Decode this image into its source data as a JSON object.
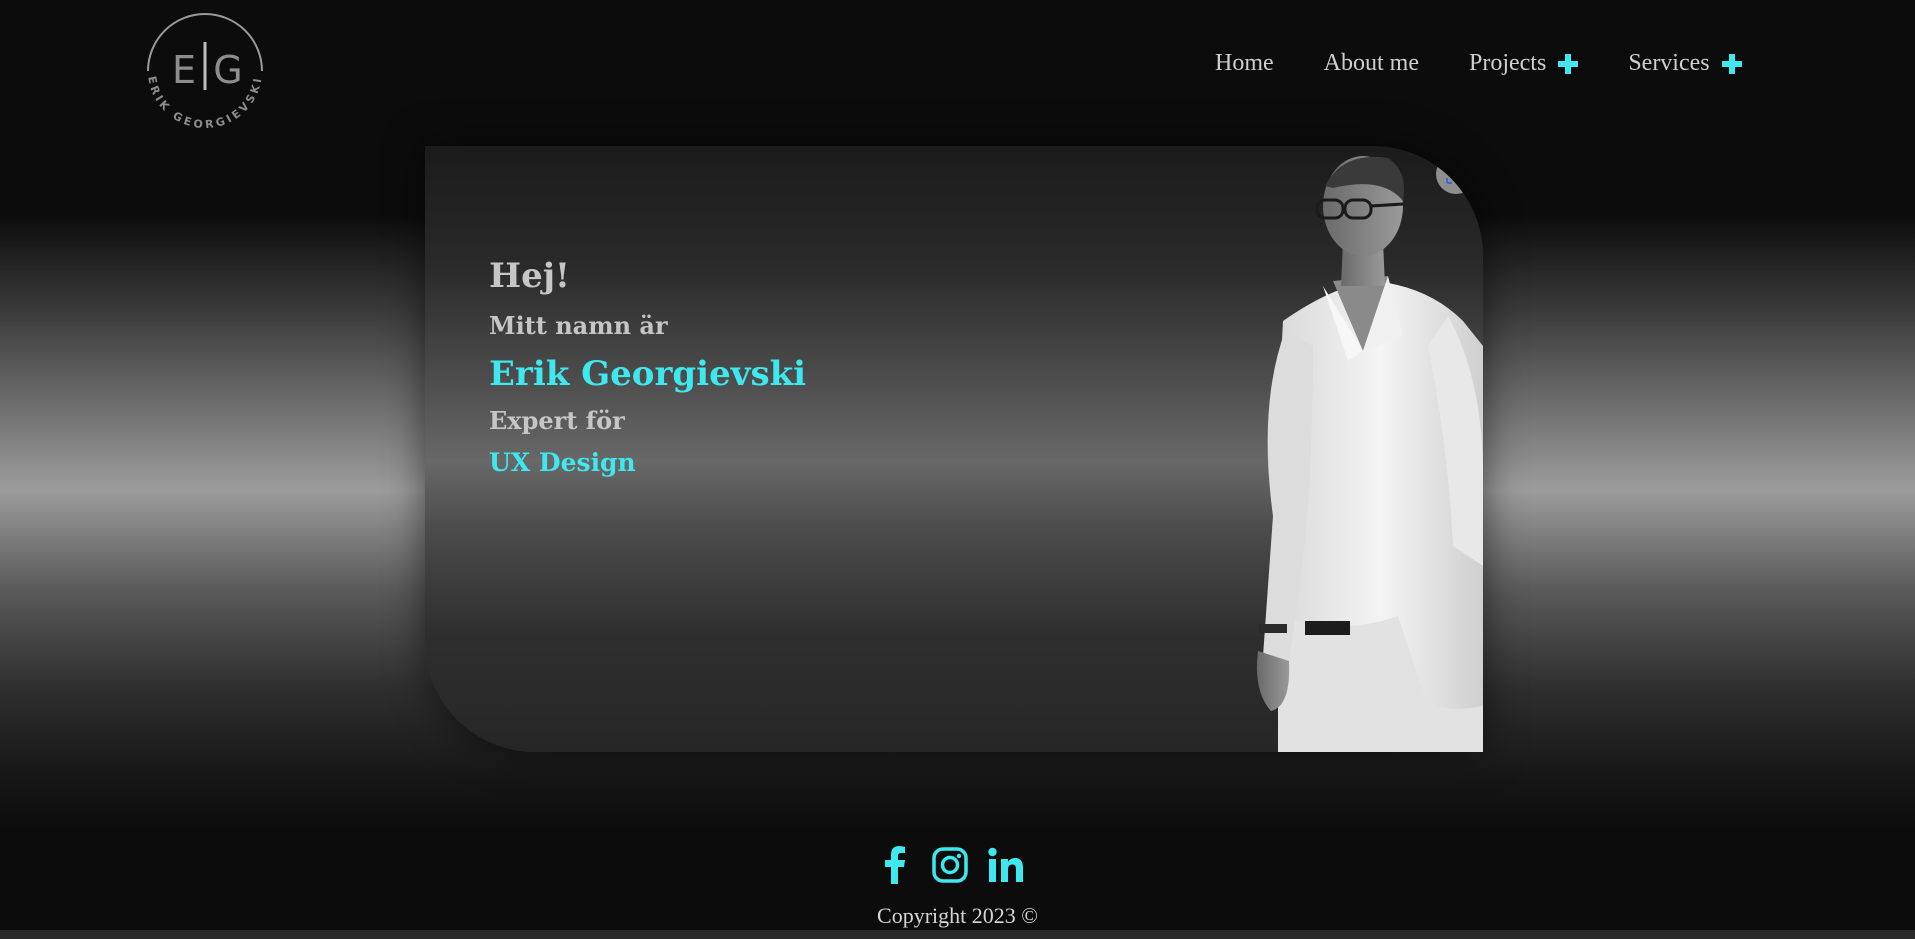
{
  "logo": {
    "monogram_left": "E",
    "monogram_right": "G",
    "ring_text": "ERIK GEORGIEVSKI"
  },
  "nav": {
    "home": "Home",
    "about": "About me",
    "projects": "Projects",
    "services": "Services"
  },
  "hero": {
    "greeting": "Hej!",
    "name_intro": "Mitt namn är",
    "name": "Erik Georgievski",
    "expert_intro": "Expert för",
    "skill": "UX Design"
  },
  "footer": {
    "copyright": "Copyright 2023 ©"
  },
  "colors": {
    "accent": "#3ee8ee",
    "text": "#c6c6c6",
    "background": "#0c0c0c"
  },
  "icons": {
    "expand": "plus-icon",
    "lens": "google-lens-icon",
    "facebook": "facebook-icon",
    "instagram": "instagram-icon",
    "linkedin": "linkedin-icon"
  }
}
